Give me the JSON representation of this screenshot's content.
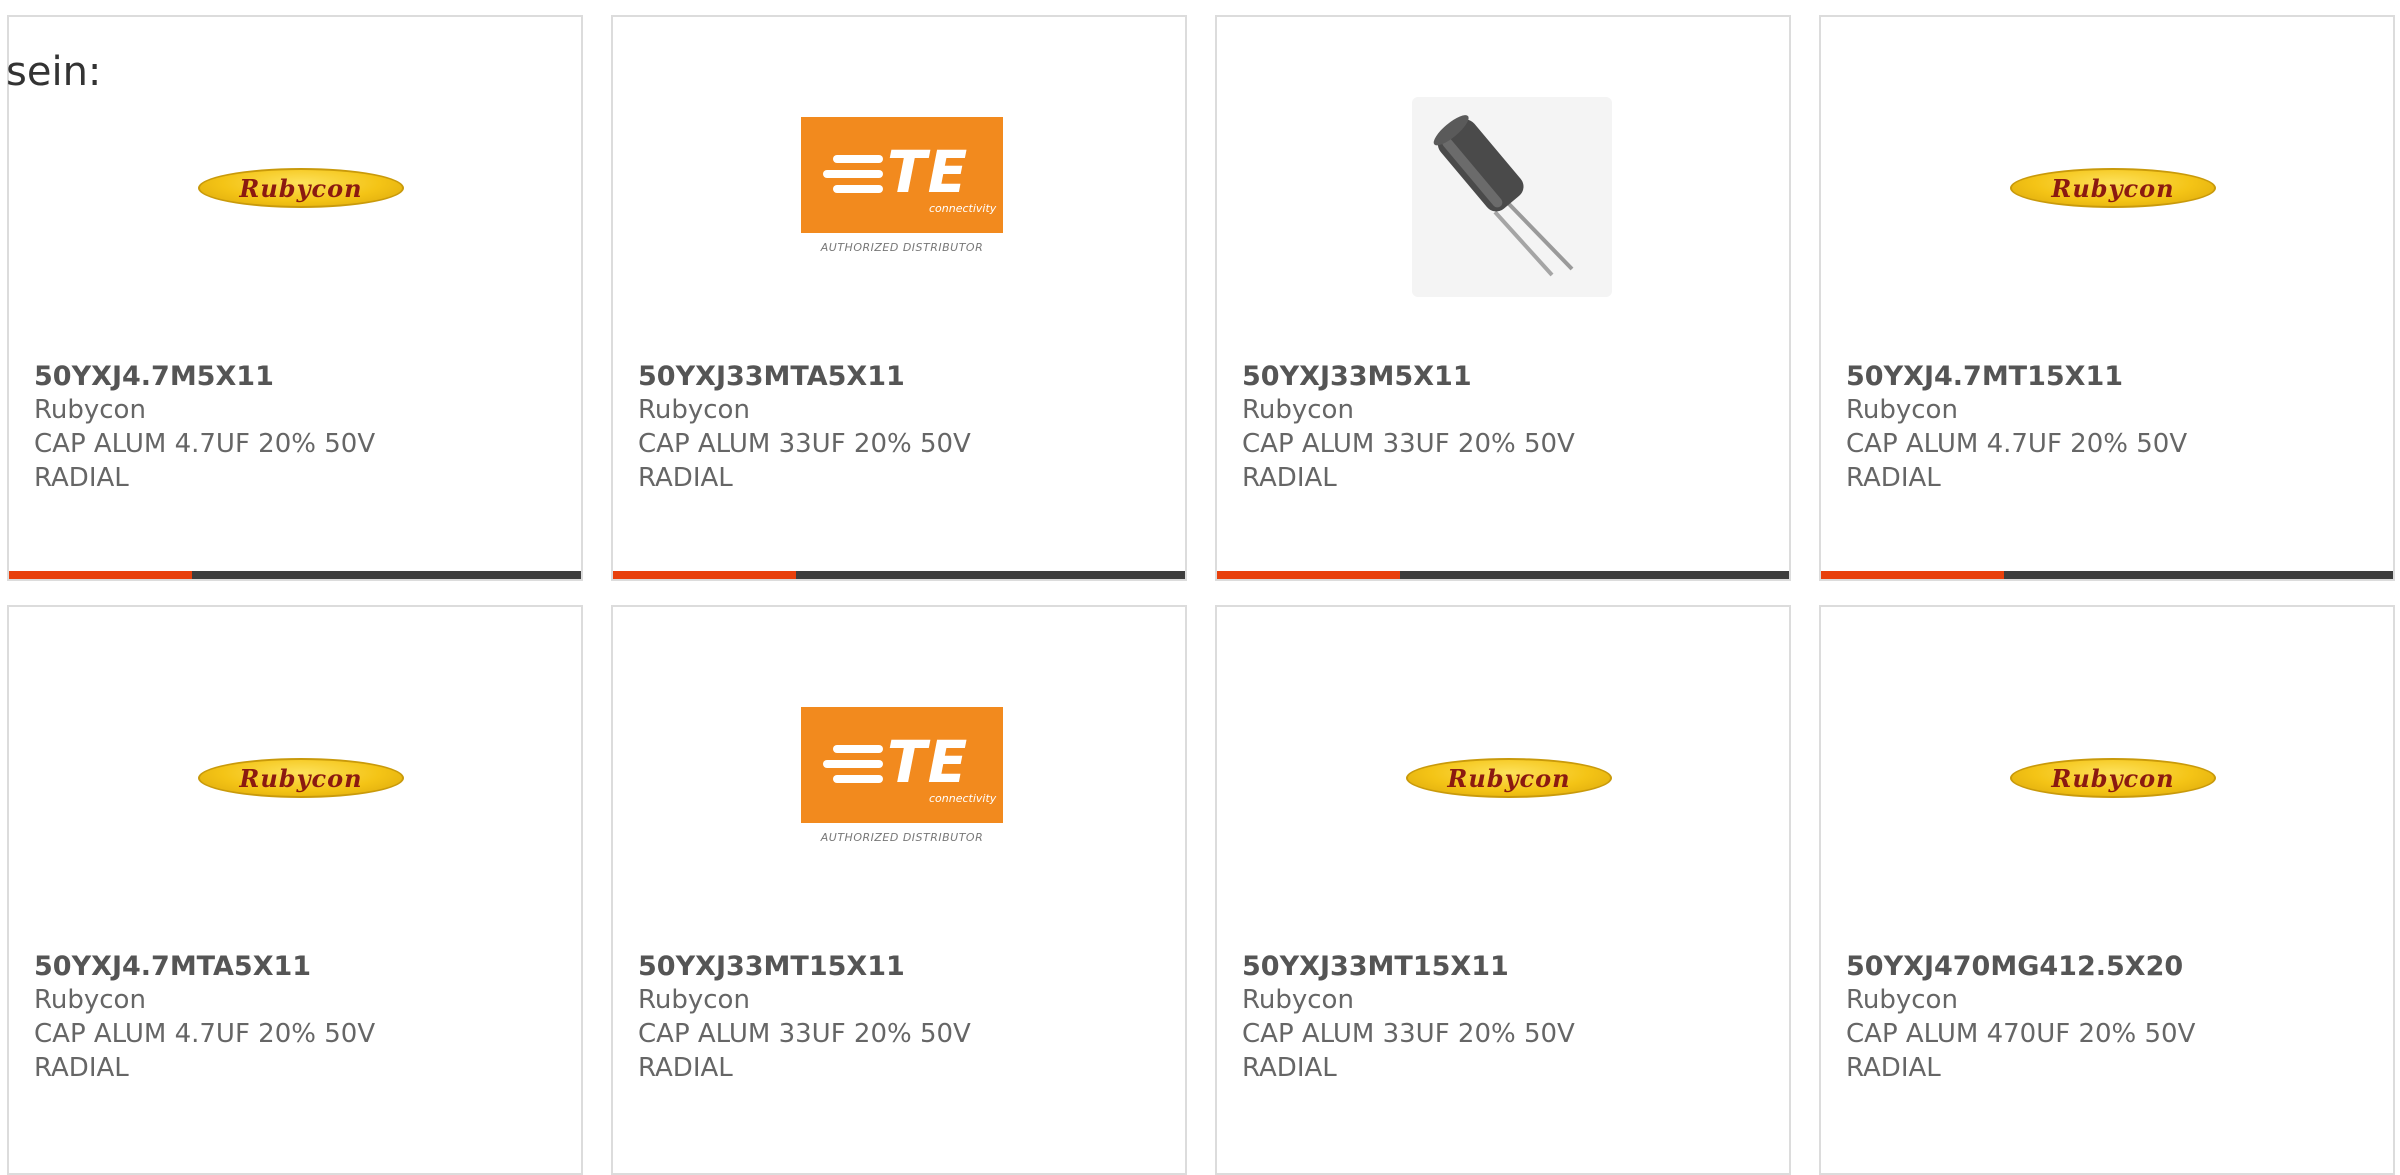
{
  "intro_text": "sein:",
  "colors": {
    "progress_track": "#3d3d3d",
    "progress_fill": "#e8400c",
    "rubycon_logo": "#f4c416",
    "te_logo": "#f28a1e"
  },
  "logos": {
    "rubycon": "Rubycon",
    "te": {
      "wordmark": "TE",
      "sub": "connectivity",
      "caption": "AUTHORIZED DISTRIBUTOR"
    }
  },
  "products": [
    {
      "part": "50YXJ4.7M5X11",
      "manufacturer": "Rubycon",
      "desc1": "CAP ALUM 4.7UF 20% 50V",
      "desc2": "RADIAL",
      "image": "rubycon-logo",
      "progress": 0.32
    },
    {
      "part": "50YXJ33MTA5X11",
      "manufacturer": "Rubycon",
      "desc1": "CAP ALUM 33UF 20% 50V",
      "desc2": "RADIAL",
      "image": "te-logo",
      "progress": 0.32
    },
    {
      "part": "50YXJ33M5X11",
      "manufacturer": "Rubycon",
      "desc1": "CAP ALUM 33UF 20% 50V",
      "desc2": "RADIAL",
      "image": "capacitor-photo",
      "progress": 0.32
    },
    {
      "part": "50YXJ4.7MT15X11",
      "manufacturer": "Rubycon",
      "desc1": "CAP ALUM 4.7UF 20% 50V",
      "desc2": "RADIAL",
      "image": "rubycon-logo",
      "progress": 0.32
    },
    {
      "part": "50YXJ4.7MTA5X11",
      "manufacturer": "Rubycon",
      "desc1": "CAP ALUM 4.7UF 20% 50V",
      "desc2": "RADIAL",
      "image": "rubycon-logo"
    },
    {
      "part": "50YXJ33MT15X11",
      "manufacturer": "Rubycon",
      "desc1": "CAP ALUM 33UF 20% 50V",
      "desc2": "RADIAL",
      "image": "te-logo"
    },
    {
      "part": "50YXJ33MT15X11",
      "manufacturer": "Rubycon",
      "desc1": "CAP ALUM 33UF 20% 50V",
      "desc2": "RADIAL",
      "image": "rubycon-logo"
    },
    {
      "part": "50YXJ470MG412.5X20",
      "manufacturer": "Rubycon",
      "desc1": "CAP ALUM 470UF 20% 50V",
      "desc2": "RADIAL",
      "image": "rubycon-logo"
    }
  ]
}
